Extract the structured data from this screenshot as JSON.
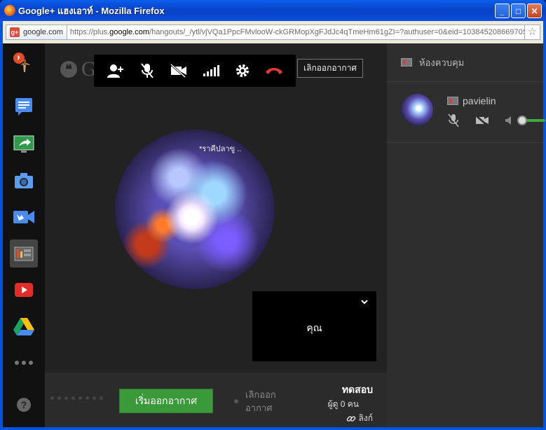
{
  "window": {
    "title": "Google+ แฮงเอาท์ - Mozilla Firefox",
    "minimize": "_",
    "maximize": "□",
    "close": "✕"
  },
  "urlbar": {
    "site": "google.com",
    "url_prefix": "https://plus.",
    "url_domain": "google.com",
    "url_rest": "/hangouts/_/ytl/vjVQa1PpcFMvlooW-ckGRMopXgFJdJc4qTmeHm61gZI=?authuser=0&eid=10384520866970S",
    "star": "☆"
  },
  "rail": {
    "items": [
      {
        "icon": "firefox-hangouts-icon"
      },
      {
        "icon": "chat-icon"
      },
      {
        "icon": "screenshare-icon"
      },
      {
        "icon": "camera-icon"
      },
      {
        "icon": "video-effects-icon"
      },
      {
        "icon": "control-room-icon"
      },
      {
        "icon": "youtube-icon"
      },
      {
        "icon": "google-drive-icon"
      },
      {
        "icon": "more-icon"
      }
    ],
    "help": "?"
  },
  "stage": {
    "logo_text": "Google+",
    "leave_button": "เลิกออกอากาศ",
    "avatar_caption": "*ราคีปลาขู ..",
    "self_label": "คุณ"
  },
  "bottombar": {
    "start_broadcast": "เริ่มออกอากาศ",
    "stop_broadcast": "เลิกออก อากาศ",
    "title": "ทดสอบ",
    "viewers": "ผู้ดู 0 คน",
    "link": "ลิงก์"
  },
  "rightpanel": {
    "header": "ห้องควบคุม",
    "user_name": "pavielin"
  },
  "colors": {
    "accent_green": "#3a9a3a",
    "hangup_red": "#e53935"
  }
}
